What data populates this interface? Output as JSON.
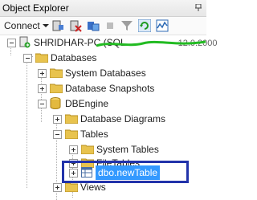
{
  "window": {
    "title": "Object Explorer"
  },
  "toolbar": {
    "connect_label": "Connect"
  },
  "tree": {
    "server": "SHRIDHAR-PC (SQL",
    "server_version_fragment": "12.0.2000",
    "databases": "Databases",
    "system_databases": "System Databases",
    "database_snapshots": "Database Snapshots",
    "dbengine": "DBEngine",
    "database_diagrams": "Database Diagrams",
    "tables": "Tables",
    "system_tables": "System Tables",
    "file_tables": "FileTables",
    "new_table": "dbo.newTable",
    "views": "Views"
  },
  "colors": {
    "highlight_box": "#2233aa",
    "selection": "#3399ff",
    "scribble": "#22bb22"
  }
}
